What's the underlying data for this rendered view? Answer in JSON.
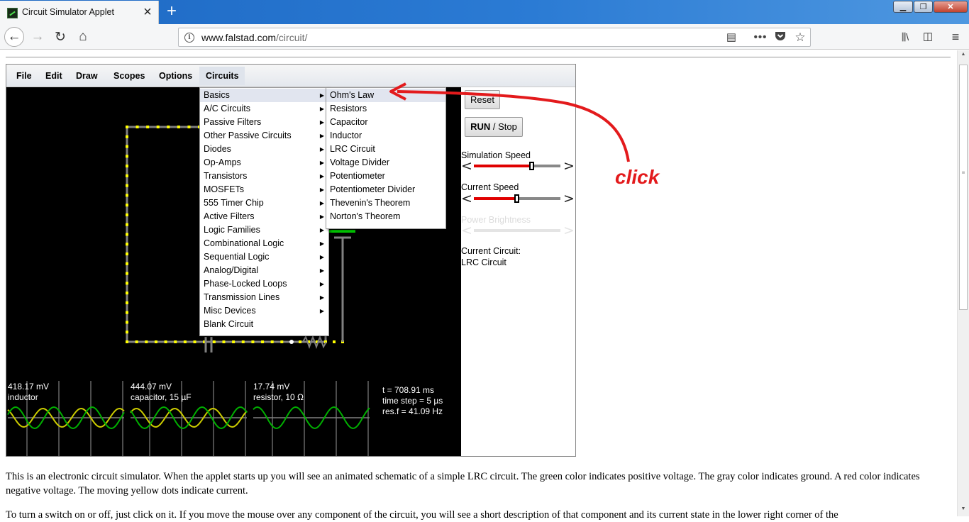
{
  "browser": {
    "tab_title": "Circuit Simulator Applet",
    "url_host": "www.falstad.com",
    "url_path": "/circuit/"
  },
  "applet": {
    "menubar": [
      "File",
      "Edit",
      "Draw",
      "Scopes",
      "Options",
      "Circuits"
    ],
    "circuits_menu": [
      {
        "label": "Basics",
        "has_submenu": true
      },
      {
        "label": "A/C Circuits",
        "has_submenu": true
      },
      {
        "label": "Passive Filters",
        "has_submenu": true
      },
      {
        "label": "Other Passive Circuits",
        "has_submenu": true
      },
      {
        "label": "Diodes",
        "has_submenu": true
      },
      {
        "label": "Op-Amps",
        "has_submenu": true
      },
      {
        "label": "Transistors",
        "has_submenu": true
      },
      {
        "label": "MOSFETs",
        "has_submenu": true
      },
      {
        "label": "555 Timer Chip",
        "has_submenu": true
      },
      {
        "label": "Active Filters",
        "has_submenu": true
      },
      {
        "label": "Logic Families",
        "has_submenu": true
      },
      {
        "label": "Combinational Logic",
        "has_submenu": true
      },
      {
        "label": "Sequential Logic",
        "has_submenu": true
      },
      {
        "label": "Analog/Digital",
        "has_submenu": true
      },
      {
        "label": "Phase-Locked Loops",
        "has_submenu": true
      },
      {
        "label": "Transmission Lines",
        "has_submenu": true
      },
      {
        "label": "Misc Devices",
        "has_submenu": true
      },
      {
        "label": "Blank Circuit",
        "has_submenu": false
      }
    ],
    "basics_submenu": [
      "Ohm's Law",
      "Resistors",
      "Capacitor",
      "Inductor",
      "LRC Circuit",
      "Voltage Divider",
      "Potentiometer",
      "Potentiometer Divider",
      "Thevenin's Theorem",
      "Norton's Theorem"
    ],
    "side_panel": {
      "reset_label": "Reset",
      "run_bold": "RUN",
      "run_rest": " / Stop",
      "sim_speed_label": "Simulation Speed",
      "sim_speed_level": 0.67,
      "current_speed_label": "Current Speed",
      "current_speed_level": 0.5,
      "power_brightness_label": "Power Brightness",
      "current_circuit_label": "Current Circuit:",
      "current_circuit_name": "LRC Circuit"
    },
    "scopes": [
      {
        "value": "418.17 mV",
        "name": "inductor"
      },
      {
        "value": "444.07 mV",
        "name": "capacitor, 15 µF"
      },
      {
        "value": "17.74 mV",
        "name": "resistor, 10 Ω"
      }
    ],
    "sim_info": {
      "time": "t = 708.91 ms",
      "time_step": "time step = 5 µs",
      "res_f": "res.f = 41.09 Hz"
    },
    "colors": {
      "positive_voltage": "#00cc00",
      "current_dots": "#ffff00",
      "ground": "#808080",
      "negative_voltage": "#e00000"
    }
  },
  "page_text": {
    "para1": "This is an electronic circuit simulator.  When the applet starts up you will see an animated schematic of a simple LRC circuit. The green color indicates positive voltage.  The gray color indicates ground.  A red color indicates negative voltage.  The moving yellow dots indicate current.",
    "para2": "To turn a switch on or off, just click on it.  If you move the mouse over any component of the circuit, you will see a short description of that component and its current state in the lower right corner of the"
  },
  "annotation": {
    "label": "click",
    "color": "#e31a1c"
  }
}
